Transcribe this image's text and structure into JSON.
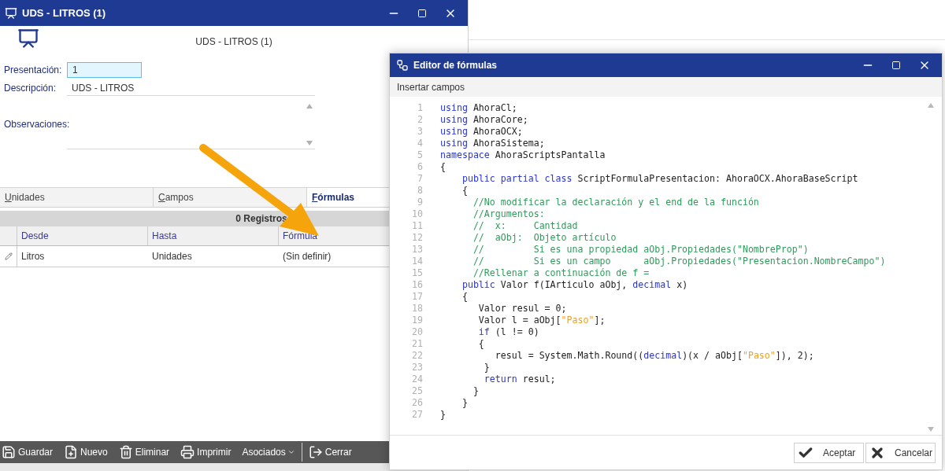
{
  "main_window": {
    "title": "UDS - LITROS (1)",
    "heading": "UDS - LITROS (1)",
    "fields": [
      {
        "kind": "input",
        "label": "Presentación:",
        "value": "1"
      },
      {
        "kind": "line",
        "label": "Descripción:",
        "value": "UDS - LITROS"
      },
      {
        "kind": "memo",
        "label": "Observaciones:"
      }
    ],
    "tabs": [
      {
        "label": "Unidades",
        "selected": false
      },
      {
        "label": "Campos",
        "selected": false
      },
      {
        "label": "Fórmulas",
        "selected": true
      }
    ],
    "grid": {
      "record_count": "0 Registros",
      "columns": [
        "Desde",
        "Hasta",
        "Fórmula"
      ],
      "rows": [
        [
          "Litros",
          "Unidades",
          "(Sin definir)"
        ]
      ]
    },
    "toolbar": [
      {
        "kind": "save",
        "label": "Guardar"
      },
      {
        "kind": "new",
        "label": "Nuevo"
      },
      {
        "kind": "delete",
        "label": "Eliminar"
      },
      {
        "kind": "print",
        "label": "Imprimir"
      },
      {
        "kind": "dropdown",
        "label": "Asociados"
      },
      {
        "kind": "separator"
      },
      {
        "kind": "exit",
        "label": "Cerrar"
      }
    ]
  },
  "formula_editor": {
    "title": "Editor de fórmulas",
    "menu": [
      "Insertar campos"
    ],
    "lines": [
      {
        "number": "1",
        "segments": [
          {
            "kind": "keyword",
            "text": "using"
          },
          {
            "kind": "plain",
            "text": " AhoraCl;"
          }
        ]
      },
      {
        "number": "2",
        "segments": [
          {
            "kind": "keyword",
            "text": "using"
          },
          {
            "kind": "plain",
            "text": " AhoraCore;"
          }
        ]
      },
      {
        "number": "3",
        "segments": [
          {
            "kind": "keyword",
            "text": "using"
          },
          {
            "kind": "plain",
            "text": " AhoraOCX;"
          }
        ]
      },
      {
        "number": "4",
        "segments": [
          {
            "kind": "keyword",
            "text": "using"
          },
          {
            "kind": "plain",
            "text": " AhoraSistema;"
          }
        ]
      },
      {
        "number": "5",
        "segments": [
          {
            "kind": "keyword",
            "text": "namespace"
          },
          {
            "kind": "plain",
            "text": " AhoraScriptsPantalla"
          }
        ]
      },
      {
        "number": "6",
        "segments": [
          {
            "kind": "plain",
            "text": "{"
          }
        ]
      },
      {
        "number": "7",
        "segments": [
          {
            "kind": "keyword",
            "text": "    public partial class"
          },
          {
            "kind": "plain",
            "text": " ScriptFormulaPresentacion: AhoraOCX.AhoraBaseScript"
          }
        ]
      },
      {
        "number": "8",
        "segments": [
          {
            "kind": "plain",
            "text": "    {"
          }
        ]
      },
      {
        "number": "9",
        "segments": [
          {
            "kind": "comment",
            "text": "      //No modificar la declaración y el end de la función"
          }
        ]
      },
      {
        "number": "10",
        "segments": [
          {
            "kind": "comment",
            "text": "      //Argumentos:"
          }
        ]
      },
      {
        "number": "11",
        "segments": [
          {
            "kind": "comment",
            "text": "      //  x:     Cantidad"
          }
        ]
      },
      {
        "number": "12",
        "segments": [
          {
            "kind": "comment",
            "text": "      //  aObj:  Objeto artículo"
          }
        ]
      },
      {
        "number": "13",
        "segments": [
          {
            "kind": "comment",
            "text": "      //         Si es una propiedad aObj.Propiedades(\"NombreProp\")"
          }
        ]
      },
      {
        "number": "14",
        "segments": [
          {
            "kind": "comment",
            "text": "      //         Si es un campo      aObj.Propiedades(\"Presentacion.NombreCampo\")"
          }
        ]
      },
      {
        "number": "15",
        "segments": [
          {
            "kind": "comment",
            "text": "      //Rellenar a continuación de f ="
          }
        ]
      },
      {
        "number": "16",
        "segments": [
          {
            "kind": "keyword",
            "text": "    public"
          },
          {
            "kind": "plain",
            "text": " Valor f(IArticulo aObj, "
          },
          {
            "kind": "keyword",
            "text": "decimal"
          },
          {
            "kind": "plain",
            "text": " x)"
          }
        ]
      },
      {
        "number": "17",
        "segments": [
          {
            "kind": "plain",
            "text": "    {"
          }
        ]
      },
      {
        "number": "18",
        "segments": [
          {
            "kind": "plain",
            "text": "       Valor resul = 0;"
          }
        ]
      },
      {
        "number": "19",
        "segments": [
          {
            "kind": "plain",
            "text": "       Valor l = aObj["
          },
          {
            "kind": "string",
            "text": "\"Paso\""
          },
          {
            "kind": "plain",
            "text": "];"
          }
        ]
      },
      {
        "number": "20",
        "segments": [
          {
            "kind": "keyword",
            "text": "       if"
          },
          {
            "kind": "plain",
            "text": " (l != 0)"
          }
        ]
      },
      {
        "number": "21",
        "segments": [
          {
            "kind": "plain",
            "text": "       {"
          }
        ]
      },
      {
        "number": "22",
        "segments": [
          {
            "kind": "plain",
            "text": "          resul = System.Math.Round(("
          },
          {
            "kind": "keyword",
            "text": "decimal"
          },
          {
            "kind": "plain",
            "text": ")(x / aObj["
          },
          {
            "kind": "string",
            "text": "\"Paso\""
          },
          {
            "kind": "plain",
            "text": "]), 2);"
          }
        ]
      },
      {
        "number": "23",
        "segments": [
          {
            "kind": "plain",
            "text": "        }"
          }
        ]
      },
      {
        "number": "24",
        "segments": [
          {
            "kind": "keyword",
            "text": "        return"
          },
          {
            "kind": "plain",
            "text": " resul;"
          }
        ]
      },
      {
        "number": "25",
        "segments": [
          {
            "kind": "plain",
            "text": "      }"
          }
        ]
      },
      {
        "number": "26",
        "segments": [
          {
            "kind": "plain",
            "text": "    }"
          }
        ]
      },
      {
        "number": "27",
        "segments": [
          {
            "kind": "plain",
            "text": "}"
          }
        ]
      }
    ],
    "buttons": [
      {
        "kind": "accept",
        "label": "Aceptar"
      },
      {
        "kind": "cancel",
        "label": "Cancelar"
      }
    ]
  }
}
